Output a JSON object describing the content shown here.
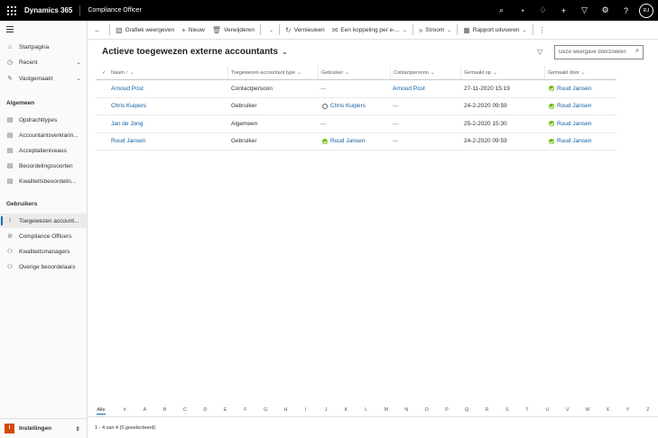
{
  "topbar": {
    "brand": "Dynamics 365",
    "app_name": "Compliance Officer",
    "icons": [
      "search-icon",
      "task-icon",
      "lightbulb-icon",
      "plus-icon",
      "filter-icon",
      "gear-icon",
      "help-icon"
    ],
    "avatar_initials": "RJ"
  },
  "sidebar": {
    "top_items": [
      {
        "label": "Startpagina",
        "icon": "home-icon"
      },
      {
        "label": "Recent",
        "icon": "clock-icon"
      },
      {
        "label": "Vastgemaakt",
        "icon": "pin-icon"
      }
    ],
    "section_general": "Algemeen",
    "general_items": [
      {
        "label": "Opdrachttypes"
      },
      {
        "label": "Accountantsverklarin..."
      },
      {
        "label": "Acceptatieniveaus"
      },
      {
        "label": "Beoordelingssoorten"
      },
      {
        "label": "Kwaliteitsbeoordelin..."
      }
    ],
    "section_users": "Gebruikers",
    "user_items": [
      {
        "label": "Toegewezen account..."
      },
      {
        "label": "Compliance Officers"
      },
      {
        "label": "Kwaliteitsmanagers"
      },
      {
        "label": "Overige beoordelaars"
      }
    ],
    "area": {
      "badge": "I",
      "label": "Instellingen"
    }
  },
  "commandbar": {
    "back": "←",
    "chart": "Grafiek weergeven",
    "new": "Nieuw",
    "delete": "Verwijderen",
    "refresh": "Vernieuwen",
    "email_link": "Een koppeling per e-...",
    "flow": "Stroom",
    "export": "Rapport uitvoeren",
    "more": "⋮"
  },
  "view": {
    "title": "Actieve toegewezen externe accountants",
    "search_placeholder": "Deze weergave doorzoeken"
  },
  "grid": {
    "columns": [
      "Naam ↑",
      "Toegewezen accountant type",
      "Gebruiker",
      "Contactpersoon",
      "Gemaakt op",
      "Gemaakt door"
    ],
    "rows": [
      {
        "naam": "Arnoud Post",
        "type": "Contactpersoon",
        "gebruiker": "---",
        "contact": "Arnoud Post",
        "gemaakt_op": "27-11-2020 15:19",
        "gemaakt_door": "Ruud Jansen"
      },
      {
        "naam": "Chris Kuipers",
        "type": "Gebruiker",
        "gebruiker": "Chris Kuipers",
        "contact": "---",
        "gemaakt_op": "24-2-2020 09:59",
        "gemaakt_door": "Ruud Jansen"
      },
      {
        "naam": "Jan de Jong",
        "type": "Algemeen",
        "gebruiker": "---",
        "contact": "---",
        "gemaakt_op": "25-2-2020 15:30",
        "gemaakt_door": "Ruud Jansen"
      },
      {
        "naam": "Ruud Jansen",
        "type": "Gebruiker",
        "gebruiker": "Ruud Jansen",
        "contact": "---",
        "gemaakt_op": "24-2-2020 09:59",
        "gemaakt_door": "Ruud Jansen"
      }
    ]
  },
  "jumpbar": [
    "Alle",
    "#",
    "A",
    "B",
    "C",
    "D",
    "E",
    "F",
    "G",
    "H",
    "I",
    "J",
    "K",
    "L",
    "M",
    "N",
    "O",
    "P",
    "Q",
    "R",
    "S",
    "T",
    "U",
    "V",
    "W",
    "X",
    "Y",
    "Z"
  ],
  "status": "1 - 4 van 4 (0 geselecteerd)",
  "colors": {
    "accent": "#0f6cbd",
    "link": "#115ea3",
    "online": "#6bb700",
    "topbar": "#000000"
  }
}
